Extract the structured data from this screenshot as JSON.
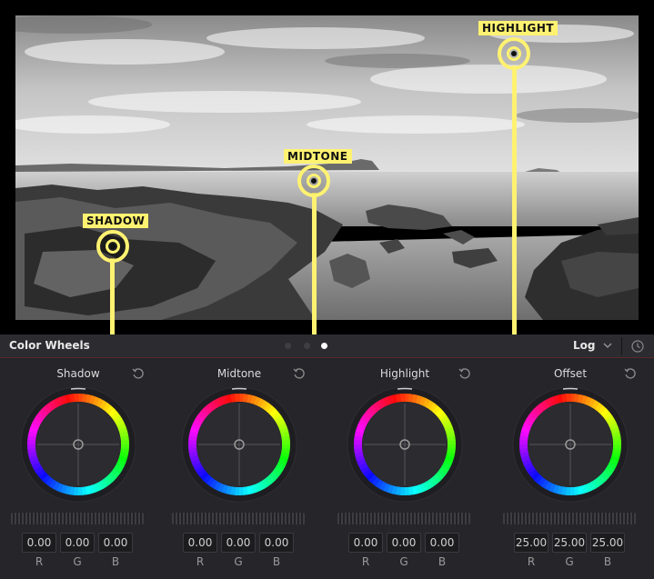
{
  "viewer": {
    "markers": [
      {
        "id": "shadow",
        "label": "SHADOW"
      },
      {
        "id": "midtone",
        "label": "MIDTONE"
      },
      {
        "id": "highlight",
        "label": "HIGHLIGHT"
      }
    ]
  },
  "panel": {
    "title": "Color Wheels",
    "mode": "Log",
    "page_count": 3,
    "active_page": 2
  },
  "wheels": [
    {
      "name": "Shadow",
      "values": [
        "0.00",
        "0.00",
        "0.00"
      ]
    },
    {
      "name": "Midtone",
      "values": [
        "0.00",
        "0.00",
        "0.00"
      ]
    },
    {
      "name": "Highlight",
      "values": [
        "0.00",
        "0.00",
        "0.00"
      ]
    },
    {
      "name": "Offset",
      "values": [
        "25.00",
        "25.00",
        "25.00"
      ]
    }
  ],
  "channels": [
    "R",
    "G",
    "B"
  ],
  "icons": {
    "reset": "reset-icon",
    "chevron": "chevron-down-icon",
    "panel_reset": "panel-reset-icon"
  },
  "colors": {
    "marker": "#fff271",
    "panel_bg": "#25252a",
    "header_bg": "#2b2b30"
  }
}
